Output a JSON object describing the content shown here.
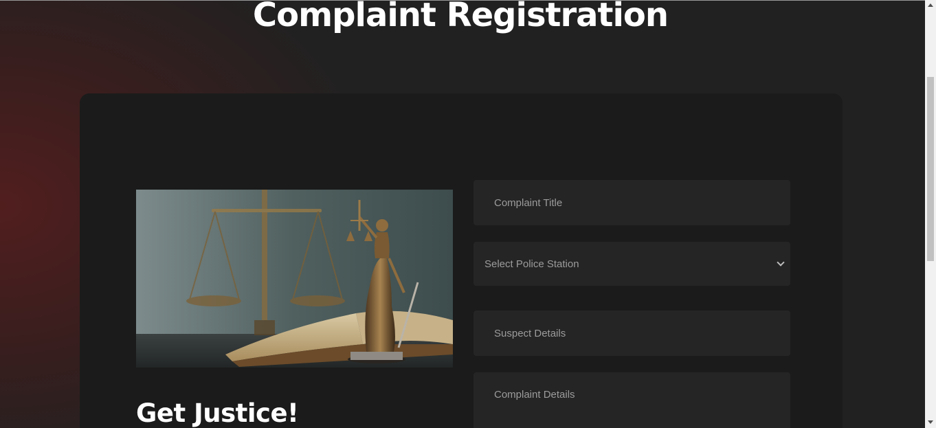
{
  "page": {
    "title": "Complaint Registration",
    "tagline": "Get Justice!"
  },
  "hero_image": {
    "description_icon": "lady-justice-scales-book-image"
  },
  "form": {
    "complaint_title": {
      "placeholder": "Complaint Title",
      "value": ""
    },
    "police_station": {
      "selected": "Select Police Station"
    },
    "suspect_details": {
      "placeholder": "Suspect Details",
      "value": ""
    },
    "complaint_details": {
      "placeholder": "Complaint Details",
      "value": ""
    }
  },
  "colors": {
    "background": "#212121",
    "card": "#1b1b1b",
    "field": "#252525",
    "accent_gradient": "#5a1e1e",
    "placeholder_text": "#9c9c9c"
  }
}
